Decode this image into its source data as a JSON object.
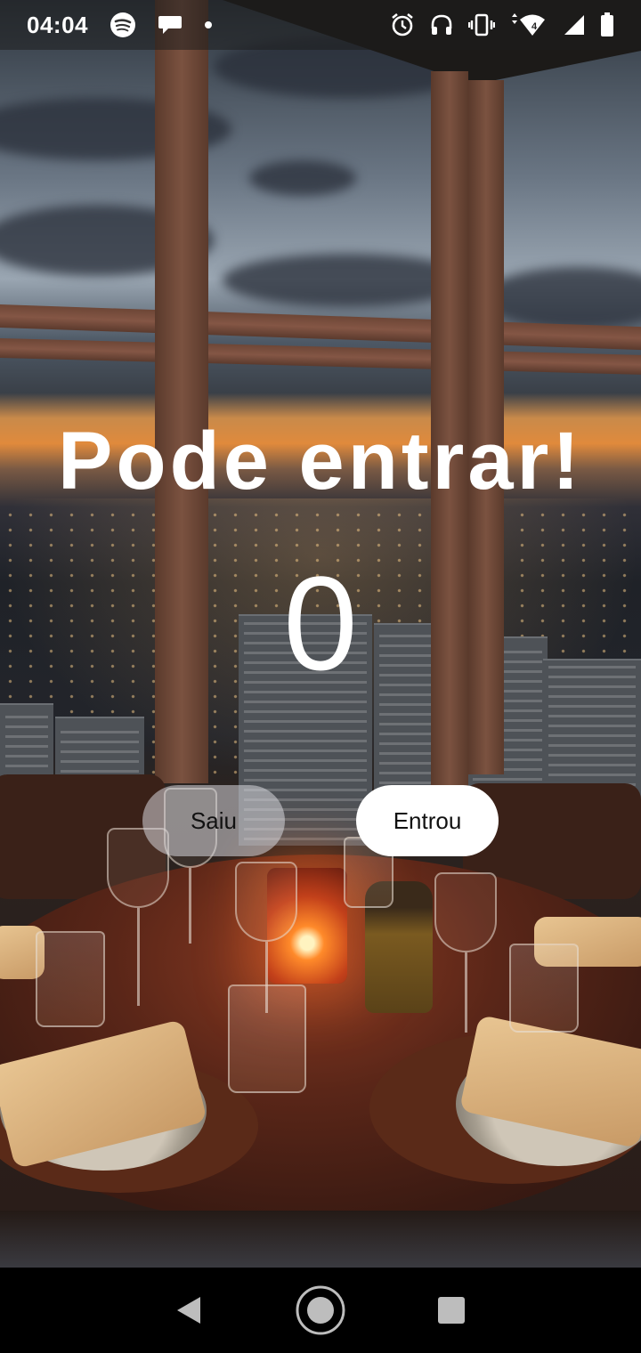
{
  "status_bar": {
    "time": "04:04",
    "left_icons": [
      "spotify-icon",
      "chat-bubble-icon",
      "notification-dot-icon"
    ],
    "right_icons": [
      "alarm-icon",
      "headphones-icon",
      "vibrate-icon",
      "wifi-icon",
      "cell-signal-icon",
      "battery-icon"
    ],
    "network_badge": "4"
  },
  "main": {
    "title": "Pode entrar!",
    "counter": "0",
    "buttons": {
      "left_label": "Saiu",
      "right_label": "Entrou"
    }
  },
  "nav_bar": {
    "icons": [
      "back-icon",
      "home-icon",
      "recents-icon"
    ]
  },
  "colors": {
    "text": "#ffffff",
    "button_primary": "#ffffff",
    "button_secondary": "#d7d7dc"
  }
}
